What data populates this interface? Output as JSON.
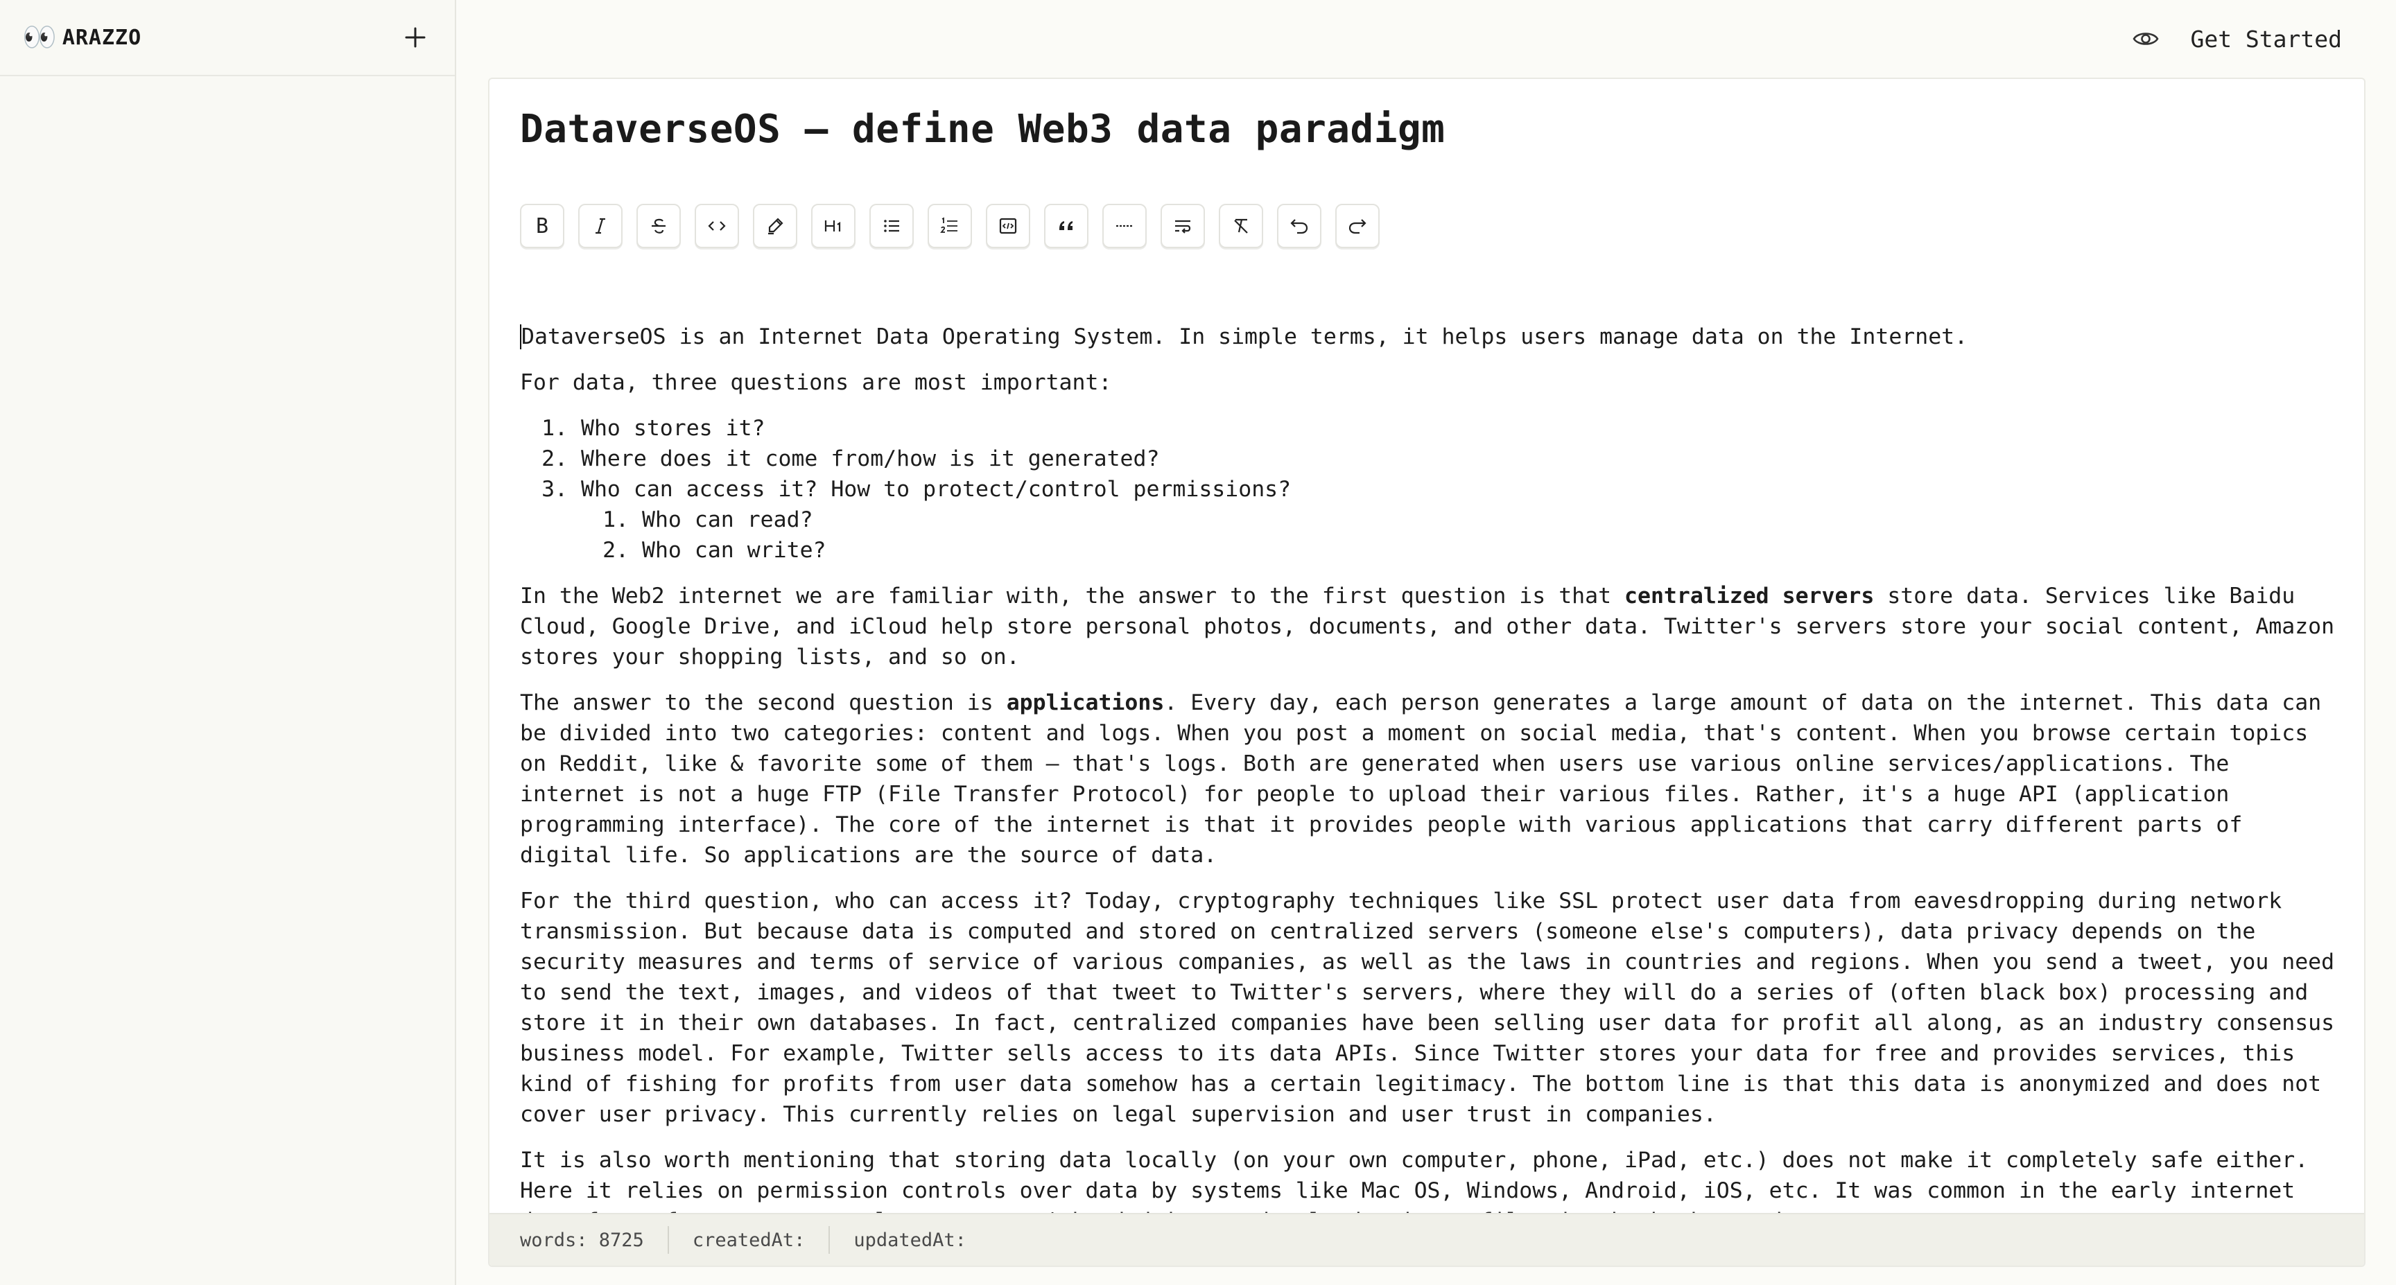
{
  "sidebar": {
    "brand": "ARAZZO",
    "logo_icon": "eyes-icon",
    "new_label": "+"
  },
  "topbar": {
    "preview_icon": "eye-icon",
    "get_started": "Get Started"
  },
  "document": {
    "title": "DataverseOS – define Web3 data paradigm",
    "toolbar": [
      {
        "name": "bold-button",
        "icon": "bold-icon",
        "text": "B"
      },
      {
        "name": "italic-button",
        "icon": "italic-icon",
        "text": "I"
      },
      {
        "name": "strikethrough-button",
        "icon": "strikethrough-icon",
        "text": "S"
      },
      {
        "name": "code-button",
        "icon": "code-icon",
        "text": "‹›"
      },
      {
        "name": "highlight-button",
        "icon": "highlighter-icon",
        "text": ""
      },
      {
        "name": "heading-button",
        "icon": "heading-icon",
        "text": "H1"
      },
      {
        "name": "bullet-list-button",
        "icon": "bullet-list-icon",
        "text": ""
      },
      {
        "name": "ordered-list-button",
        "icon": "ordered-list-icon",
        "text": ""
      },
      {
        "name": "code-block-button",
        "icon": "code-block-icon",
        "text": ""
      },
      {
        "name": "blockquote-button",
        "icon": "quote-icon",
        "text": ""
      },
      {
        "name": "horizontal-rule-button",
        "icon": "horizontal-rule-icon",
        "text": ""
      },
      {
        "name": "hard-break-button",
        "icon": "wrap-icon",
        "text": ""
      },
      {
        "name": "clear-format-button",
        "icon": "clear-format-icon",
        "text": ""
      },
      {
        "name": "undo-button",
        "icon": "undo-icon",
        "text": ""
      },
      {
        "name": "redo-button",
        "icon": "redo-icon",
        "text": ""
      }
    ],
    "p1": "DataverseOS is an Internet Data Operating System. In simple terms, it helps users manage data on the Internet.",
    "p2": "For data, three questions are most important:",
    "list": [
      "Who stores it?",
      "Where does it come from/how is it generated?",
      "Who can access it? How to protect/control permissions?"
    ],
    "sublist": [
      "Who can read?",
      "Who can write?"
    ],
    "p3_a": "In the Web2 internet we are familiar with, the answer to the first question is that ",
    "p3_bold": "centralized servers",
    "p3_b": " store data. Services like Baidu Cloud, Google Drive, and iCloud help store personal photos, documents, and other data. Twitter's servers store your social content, Amazon stores your shopping lists, and so on.",
    "p4_a": "The answer to the second question is ",
    "p4_bold": "applications",
    "p4_b": ". Every day, each person generates a large amount of data on the internet. This data can be divided into two categories: content and logs. When you post a moment on social media, that's content. When you browse certain topics on Reddit, like & favorite some of them – that's logs. Both are generated when users use various online services/applications. The internet is not a huge FTP (File Transfer Protocol) for people to upload their various files. Rather, it's a huge API (application programming interface). The core of the internet is that it provides people with various applications that carry different parts of digital life. So applications are the source of data.",
    "p5": "For the third question, who can access it? Today, cryptography techniques like SSL protect user data from eavesdropping during network transmission. But because data is computed and stored on centralized servers (someone else's computers), data privacy depends on the security measures and terms of service of various companies, as well as the laws in countries and regions. When you send a tweet, you need to send the text, images, and videos of that tweet to Twitter's servers, where they will do a series of (often black box) processing and store it in their own databases. In fact, centralized companies have been selling user data for profit all along, as an industry consensus business model. For example, Twitter sells access to its data APIs. Since Twitter stores your data for free and provides services, this kind of fishing for profits from user data somehow has a certain legitimacy. The bottom line is that this data is anonymized and does not cover user privacy. This currently relies on legal supervision and user trust in companies.",
    "p6": "It is also worth mentioning that storing data locally (on your own computer, phone, iPad, etc.) does not make it completely safe either. Here it relies on permission controls over data by systems like Mac OS, Windows, Android, iOS, etc. It was common in the early internet days for software to secretly scan users' hard drives and upload private files in the background."
  },
  "footer": {
    "words": "words: 8725",
    "created": "createdAt:",
    "updated": "updatedAt:"
  }
}
